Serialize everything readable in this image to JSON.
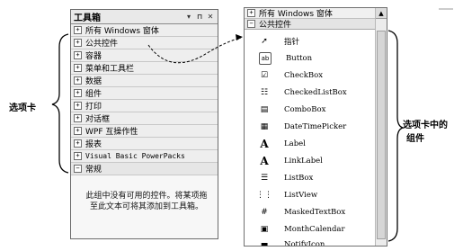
{
  "toolbox": {
    "title": "工具箱",
    "controls": [
      "▾",
      "⊓",
      "✕"
    ],
    "tabs": [
      {
        "label": "所有 Windows 窗体",
        "expander": "+",
        "mono": false
      },
      {
        "label": "公共控件",
        "expander": "+",
        "mono": false
      },
      {
        "label": "容器",
        "expander": "+",
        "mono": false
      },
      {
        "label": "菜单和工具栏",
        "expander": "+",
        "mono": false
      },
      {
        "label": "数据",
        "expander": "+",
        "mono": false
      },
      {
        "label": "组件",
        "expander": "+",
        "mono": false
      },
      {
        "label": "打印",
        "expander": "+",
        "mono": false
      },
      {
        "label": "对话框",
        "expander": "+",
        "mono": false
      },
      {
        "label": "WPF 互操作性",
        "expander": "+",
        "mono": false
      },
      {
        "label": "报表",
        "expander": "+",
        "mono": false
      },
      {
        "label": "Visual Basic PowerPacks",
        "expander": "+",
        "mono": true
      },
      {
        "label": "常规",
        "expander": "−",
        "mono": false
      }
    ],
    "empty_message": "此组中没有可用的控件。将某项拖至此文本可将其添加到工具箱。"
  },
  "list": {
    "header": "所有 Windows 窗体",
    "header_expander": "+",
    "subheader": "公共控件",
    "subheader_expander": "−",
    "items": [
      {
        "label": "指针",
        "icon": "pointer-icon"
      },
      {
        "label": "Button",
        "icon": "button-icon"
      },
      {
        "label": "CheckBox",
        "icon": "checkbox-icon"
      },
      {
        "label": "CheckedListBox",
        "icon": "checkedlistbox-icon"
      },
      {
        "label": "ComboBox",
        "icon": "combobox-icon"
      },
      {
        "label": "DateTimePicker",
        "icon": "datetimepicker-icon"
      },
      {
        "label": "Label",
        "icon": "label-icon"
      },
      {
        "label": "LinkLabel",
        "icon": "linklabel-icon"
      },
      {
        "label": "ListBox",
        "icon": "listbox-icon"
      },
      {
        "label": "ListView",
        "icon": "listview-icon"
      },
      {
        "label": "MaskedTextBox",
        "icon": "maskedtextbox-icon"
      },
      {
        "label": "MonthCalendar",
        "icon": "monthcalendar-icon"
      },
      {
        "label": "NotifyIcon",
        "icon": "notifyicon-icon"
      }
    ]
  },
  "annotations": {
    "left": "选项卡",
    "right_line1": "选项卡中的",
    "right_line2": "组件"
  }
}
